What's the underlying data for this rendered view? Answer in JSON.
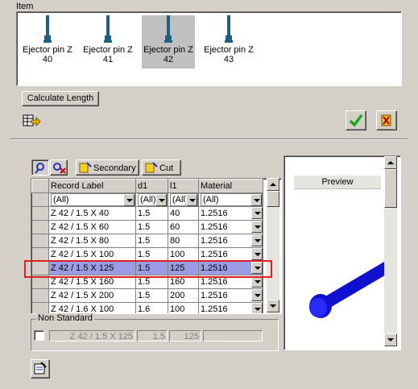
{
  "item_group": {
    "label": "Item"
  },
  "items": [
    {
      "name": "Ejector pin Z",
      "size": "40",
      "selected": false
    },
    {
      "name": "Ejector pin Z",
      "size": "41",
      "selected": false
    },
    {
      "name": "Ejector pin Z",
      "size": "42",
      "selected": true
    },
    {
      "name": "Ejector pin Z",
      "size": "43",
      "selected": false
    }
  ],
  "calculate_length_label": "Calculate Length",
  "toolbar": {
    "secondary_label": "Secondary",
    "cut_label": "Cut"
  },
  "grid": {
    "columns": [
      "Record Label",
      "d1",
      "l1",
      "Material"
    ],
    "filters": [
      "(All)",
      "(All)",
      "(All)",
      "(All)"
    ],
    "rows": [
      {
        "label": "Z 42 / 1.5 X 40",
        "d1": "1.5",
        "l1": "40",
        "material": "1.2516"
      },
      {
        "label": "Z 42 / 1.5 X 60",
        "d1": "1.5",
        "l1": "60",
        "material": "1.2516"
      },
      {
        "label": "Z 42 / 1.5 X 80",
        "d1": "1.5",
        "l1": "80",
        "material": "1.2516"
      },
      {
        "label": "Z 42 / 1.5 X 100",
        "d1": "1.5",
        "l1": "100",
        "material": "1.2516"
      },
      {
        "label": "Z 42 / 1.5 X 125",
        "d1": "1.5",
        "l1": "125",
        "material": "1.2516"
      },
      {
        "label": "Z 42 / 1.5 X 160",
        "d1": "1.5",
        "l1": "160",
        "material": "1.2516"
      },
      {
        "label": "Z 42 / 1.5 X 200",
        "d1": "1.5",
        "l1": "200",
        "material": "1.2516"
      },
      {
        "label": "Z 42 / 1.6 X 100",
        "d1": "1.6",
        "l1": "100",
        "material": "1.2516"
      }
    ],
    "selected_index": 4
  },
  "preview_label": "Preview",
  "non_standard": {
    "label": "Non Standard",
    "record_label": "Z 42 / 1.5 X 125",
    "d1": "1.5",
    "l1": "125",
    "material": ""
  },
  "colors": {
    "selection": "#9b9ce4",
    "highlight_box": "#e02020",
    "ok_check": "#1aa51a",
    "pin_blue": "#1010d0",
    "pin_teal": "#1f5f7f"
  }
}
